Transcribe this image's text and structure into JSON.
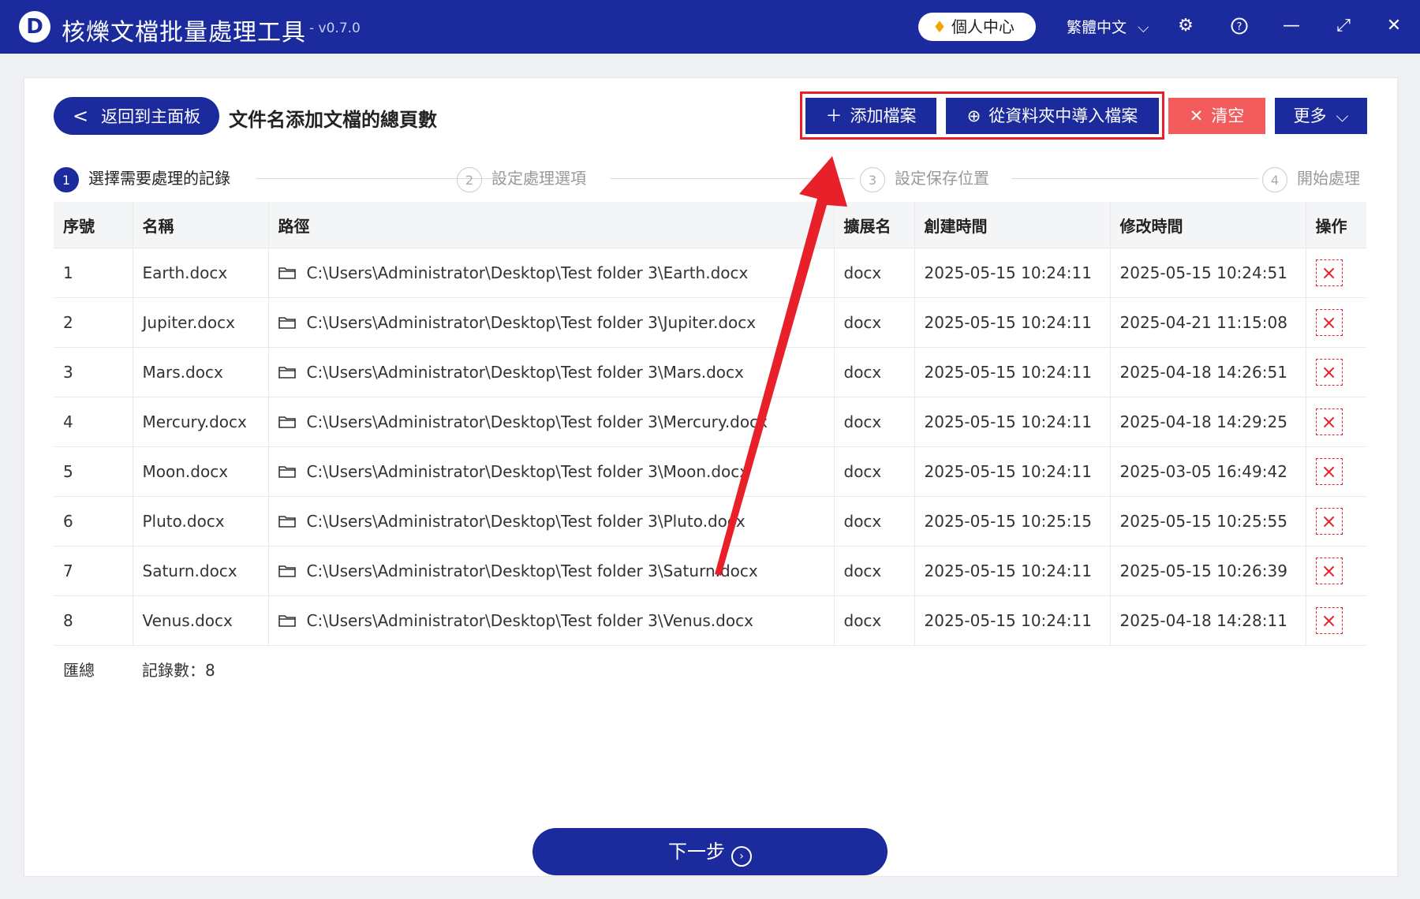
{
  "app": {
    "logo_letter": "D",
    "title": "核爍文檔批量處理工具",
    "version": "- v0.7.0",
    "personal_center": "個人中心",
    "language": "繁體中文",
    "icons": [
      "gear-icon",
      "help-icon",
      "minimize-icon",
      "maximize-icon",
      "close-icon"
    ]
  },
  "header": {
    "back_label": "返回到主面板",
    "page_title": "文件名添加文檔的總頁數",
    "add_files": "添加檔案",
    "import_folder": "從資料夾中導入檔案",
    "clear": "清空",
    "more": "更多"
  },
  "steps": [
    {
      "num": "1",
      "label": "選擇需要處理的記錄",
      "active": true
    },
    {
      "num": "2",
      "label": "設定處理選項",
      "active": false
    },
    {
      "num": "3",
      "label": "設定保存位置",
      "active": false
    },
    {
      "num": "4",
      "label": "開始處理",
      "active": false
    }
  ],
  "table": {
    "headers": [
      "序號",
      "名稱",
      "路徑",
      "擴展名",
      "創建時間",
      "修改時間",
      "操作"
    ],
    "rows": [
      {
        "idx": "1",
        "name": "Earth.docx",
        "path": "C:\\Users\\Administrator\\Desktop\\Test folder 3\\Earth.docx",
        "ext": "docx",
        "created": "2025-05-15 10:24:11",
        "modified": "2025-05-15 10:24:51"
      },
      {
        "idx": "2",
        "name": "Jupiter.docx",
        "path": "C:\\Users\\Administrator\\Desktop\\Test folder 3\\Jupiter.docx",
        "ext": "docx",
        "created": "2025-05-15 10:24:11",
        "modified": "2025-04-21 11:15:08"
      },
      {
        "idx": "3",
        "name": "Mars.docx",
        "path": "C:\\Users\\Administrator\\Desktop\\Test folder 3\\Mars.docx",
        "ext": "docx",
        "created": "2025-05-15 10:24:11",
        "modified": "2025-04-18 14:26:51"
      },
      {
        "idx": "4",
        "name": "Mercury.docx",
        "path": "C:\\Users\\Administrator\\Desktop\\Test folder 3\\Mercury.docx",
        "ext": "docx",
        "created": "2025-05-15 10:24:11",
        "modified": "2025-04-18 14:29:25"
      },
      {
        "idx": "5",
        "name": "Moon.docx",
        "path": "C:\\Users\\Administrator\\Desktop\\Test folder 3\\Moon.docx",
        "ext": "docx",
        "created": "2025-05-15 10:24:11",
        "modified": "2025-03-05 16:49:42"
      },
      {
        "idx": "6",
        "name": "Pluto.docx",
        "path": "C:\\Users\\Administrator\\Desktop\\Test folder 3\\Pluto.docx",
        "ext": "docx",
        "created": "2025-05-15 10:25:15",
        "modified": "2025-05-15 10:25:55"
      },
      {
        "idx": "7",
        "name": "Saturn.docx",
        "path": "C:\\Users\\Administrator\\Desktop\\Test folder 3\\Saturn.docx",
        "ext": "docx",
        "created": "2025-05-15 10:24:11",
        "modified": "2025-05-15 10:26:39"
      },
      {
        "idx": "8",
        "name": "Venus.docx",
        "path": "C:\\Users\\Administrator\\Desktop\\Test folder 3\\Venus.docx",
        "ext": "docx",
        "created": "2025-05-15 10:24:11",
        "modified": "2025-04-18 14:28:11"
      }
    ],
    "summary_label": "匯總",
    "summary_count": "記錄數：8"
  },
  "footer": {
    "next_label": "下一步"
  },
  "colors": {
    "primary": "#1b2a9c",
    "danger": "#f25c5c",
    "annotation": "#e8202a"
  }
}
